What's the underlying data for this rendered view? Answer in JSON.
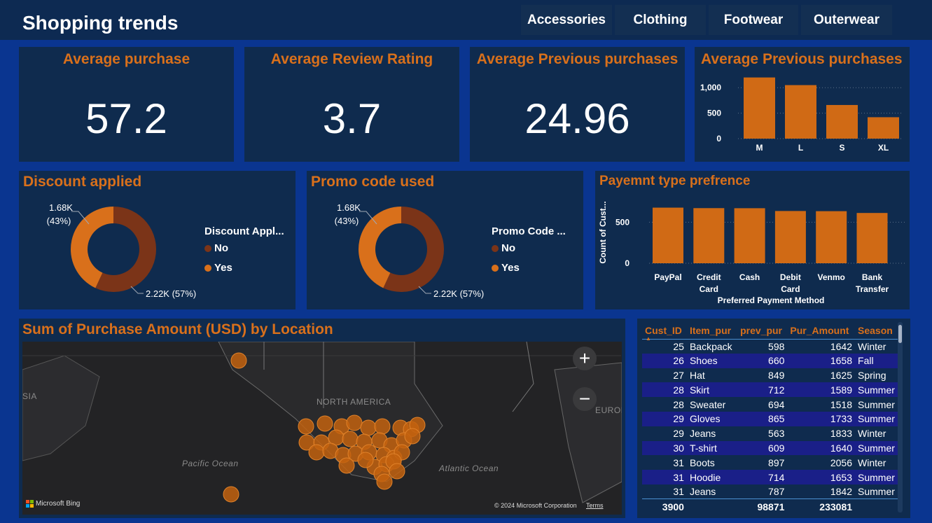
{
  "header": {
    "title": "Shopping trends",
    "tabs": [
      "Accessories",
      "Clothing",
      "Footwear",
      "Outerwear"
    ]
  },
  "kpis": {
    "avg_purchase": {
      "label": "Average purchase",
      "value": "57.2"
    },
    "avg_review": {
      "label": "Average Review Rating",
      "value": "3.7"
    },
    "avg_prev": {
      "label": "Average Previous purchases",
      "value": "24.96"
    }
  },
  "size_chart": {
    "title": "Average Previous purchases",
    "yticks": [
      "1,000",
      "500",
      "0"
    ]
  },
  "discount": {
    "title": "Discount applied",
    "legend_title": "Discount Appl...",
    "legend": [
      "No",
      "Yes"
    ],
    "label_yes_1": "1.68K",
    "label_yes_2": "(43%)",
    "label_no": "2.22K (57%)"
  },
  "promo": {
    "title": "Promo code used",
    "legend_title": "Promo Code ...",
    "legend": [
      "No",
      "Yes"
    ],
    "label_yes_1": "1.68K",
    "label_yes_2": "(43%)",
    "label_no": "2.22K (57%)"
  },
  "payment": {
    "title": "Payemnt type prefrence",
    "ylabel": "Count of Cust...",
    "xlabel": "Preferred Payment Method",
    "yticks": [
      "500",
      "0"
    ],
    "category_lines": [
      [
        "PayPal"
      ],
      [
        "Credit",
        "Card"
      ],
      [
        "Cash"
      ],
      [
        "Debit",
        "Card"
      ],
      [
        "Venmo"
      ],
      [
        "Bank",
        "Transfer"
      ]
    ]
  },
  "map": {
    "title": "Sum of Purchase Amount (USD) by Location",
    "labels": {
      "north_america": "NORTH AMERICA",
      "pacific": "Pacific Ocean",
      "atlantic": "Atlantic Ocean",
      "europe": "EUROPE",
      "asia": "SIA"
    },
    "attribution": "© 2024 Microsoft Corporation",
    "terms": "Terms",
    "brand": "Microsoft Bing",
    "zoom_in": "+",
    "zoom_out": "−"
  },
  "table": {
    "columns": [
      "Cust_ID",
      "Item_pur",
      "prev_pur",
      "Pur_Amount",
      "Season"
    ],
    "rows": [
      [
        "25",
        "Backpack",
        "598",
        "1642",
        "Winter"
      ],
      [
        "26",
        "Shoes",
        "660",
        "1658",
        "Fall"
      ],
      [
        "27",
        "Hat",
        "849",
        "1625",
        "Spring"
      ],
      [
        "28",
        "Skirt",
        "712",
        "1589",
        "Summer"
      ],
      [
        "28",
        "Sweater",
        "694",
        "1518",
        "Summer"
      ],
      [
        "29",
        "Gloves",
        "865",
        "1733",
        "Summer"
      ],
      [
        "29",
        "Jeans",
        "563",
        "1833",
        "Winter"
      ],
      [
        "30",
        "T-shirt",
        "609",
        "1640",
        "Summer"
      ],
      [
        "31",
        "Boots",
        "897",
        "2056",
        "Winter"
      ],
      [
        "31",
        "Hoodie",
        "714",
        "1653",
        "Summer"
      ],
      [
        "31",
        "Jeans",
        "787",
        "1842",
        "Summer"
      ]
    ],
    "totals": [
      "3900",
      "",
      "98871",
      "233081",
      ""
    ]
  },
  "colors": {
    "accent": "#d9701b",
    "dark_accent": "#7b3418",
    "panel": "#0f2b4e",
    "background": "#0a3590"
  },
  "chart_data": [
    {
      "type": "bar",
      "title": "Average Previous purchases",
      "categories": [
        "M",
        "L",
        "S",
        "XL"
      ],
      "values": [
        1200,
        1050,
        660,
        420
      ],
      "ylim": [
        0,
        1250
      ]
    },
    {
      "type": "pie",
      "title": "Discount applied",
      "categories": [
        "No",
        "Yes"
      ],
      "values": [
        2220,
        1680
      ],
      "colors": [
        "#7b3418",
        "#d9701b"
      ]
    },
    {
      "type": "pie",
      "title": "Promo code used",
      "categories": [
        "No",
        "Yes"
      ],
      "values": [
        2220,
        1680
      ],
      "colors": [
        "#7b3418",
        "#d9701b"
      ]
    },
    {
      "type": "bar",
      "title": "Payemnt type prefrence",
      "xlabel": "Preferred Payment Method",
      "ylabel": "Count of Cust...",
      "categories": [
        "PayPal",
        "Credit Card",
        "Cash",
        "Debit Card",
        "Venmo",
        "Bank Transfer"
      ],
      "values": [
        677,
        671,
        670,
        636,
        634,
        612
      ],
      "ylim": [
        0,
        750
      ]
    }
  ]
}
